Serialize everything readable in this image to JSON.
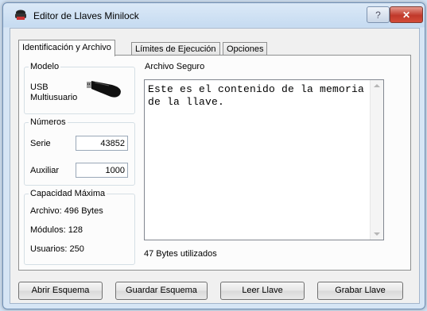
{
  "window": {
    "title": "Editor de Llaves Minilock",
    "help_label": "?",
    "close_label": "✕"
  },
  "tabs": [
    "Identificación y Archivo",
    "Límites de Ejecución",
    "Opciones"
  ],
  "modelo": {
    "group_label": "Modelo",
    "line1": "USB",
    "line2": "Multiusuario",
    "icon": "usb-key-icon"
  },
  "numeros": {
    "group_label": "Números",
    "serie_label": "Serie",
    "serie_value": "43852",
    "auxiliar_label": "Auxiliar",
    "auxiliar_value": "1000"
  },
  "capacidad": {
    "group_label": "Capacidad Máxima",
    "archivo": "Archivo:  496 Bytes",
    "modulos": "Módulos: 128",
    "usuarios": "Usuarios: 250"
  },
  "archivo_seguro": {
    "group_label": "Archivo Seguro",
    "content": "Este es el contenido de la memoria de la llave.",
    "status": "47 Bytes utilizados"
  },
  "buttons": {
    "abrir": "Abrir Esquema",
    "guardar": "Guardar Esquema",
    "leer": "Leer Llave",
    "grabar": "Grabar Llave"
  },
  "colors": {
    "titlebar": "#c6dbf1",
    "close": "#c0392b",
    "panel": "#fcfcfc"
  }
}
